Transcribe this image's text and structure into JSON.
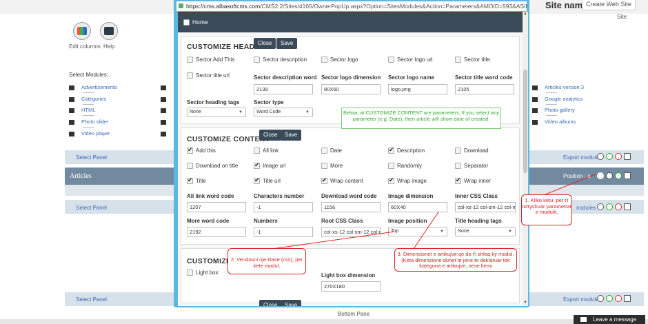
{
  "site": {
    "label": "Site name:",
    "button": "Create Web Site",
    "small": "Site:"
  },
  "background": {
    "edit_columns": "Edit columns",
    "help": "Help",
    "select_modules": "Select Modules:",
    "modules_col1": [
      "Advertisements",
      "Categories",
      "HTML",
      "Photo slider",
      "Video player"
    ],
    "modules_col2": [
      "Articles version 3",
      "Google analytics",
      "Photo gallery",
      "Video albums"
    ],
    "select_panel": "Select Panel",
    "articles": "Articles",
    "export_modules": "Export modules",
    "position": "Position : a",
    "modules_partial": "nodules",
    "bottom_pane": "Bottom Pane",
    "leave_message": "Leave a message"
  },
  "popup": {
    "url_host": "https://cms.albasoftcms.com",
    "url_path": "/CMS2.2/Sites/4165/OwnerPopUp.aspx?Option=SitesModules&Action=Parameters&AMOID=593&ASID=1&",
    "home": "Home",
    "buttons": {
      "close": "Close",
      "save": "Save"
    },
    "header": {
      "title": "CUSTOMIZE HEADER",
      "checks": [
        {
          "label": "Sector Add This",
          "checked": false
        },
        {
          "label": "Sector description",
          "checked": false
        },
        {
          "label": "Sector logo",
          "checked": false
        },
        {
          "label": "Sector logo url",
          "checked": false
        },
        {
          "label": "Sector title",
          "checked": false
        },
        {
          "label": "Sector title url",
          "checked": false
        }
      ],
      "fields": [
        {
          "label": "Sector description word",
          "value": "2139"
        },
        {
          "label": "Sector logo dimension",
          "value": "80X60"
        },
        {
          "label": "Sector logo name",
          "value": "logo.png"
        },
        {
          "label": "Sector title word code",
          "value": "2105"
        }
      ],
      "selects": [
        {
          "label": "Sector heading tags",
          "value": "None"
        },
        {
          "label": "Sector type",
          "value": "Word Code"
        }
      ]
    },
    "note": "Below, at CUSTOMIZE CONTENT are parameters. If you select any parameter (e.g. Date), then article will show date of created.",
    "content": {
      "title": "CUSTOMIZE CONTENT",
      "checks": [
        {
          "label": "Add this",
          "checked": true
        },
        {
          "label": "All link",
          "checked": false
        },
        {
          "label": "Date",
          "checked": false
        },
        {
          "label": "Description",
          "checked": true
        },
        {
          "label": "Download",
          "checked": false
        },
        {
          "label": "Download on title",
          "checked": false
        },
        {
          "label": "Image url",
          "checked": true
        },
        {
          "label": "More",
          "checked": false
        },
        {
          "label": "Randomly",
          "checked": false
        },
        {
          "label": "Separator",
          "checked": false
        },
        {
          "label": "Title",
          "checked": true
        },
        {
          "label": "Title url",
          "checked": true
        },
        {
          "label": "Wrap content",
          "checked": true
        },
        {
          "label": "Wrap image",
          "checked": true
        },
        {
          "label": "Wrap inner",
          "checked": true
        }
      ],
      "fields_row1": [
        {
          "label": "All link word code",
          "value": "1207"
        },
        {
          "label": "Characters number",
          "value": "-1"
        },
        {
          "label": "Download word code",
          "value": "1156"
        },
        {
          "label": "Image dimension",
          "value": "60X40"
        },
        {
          "label": "Inner CSS Class",
          "value": "col-xs-12 col-sm-12 col-md-"
        }
      ],
      "fields_row2": [
        {
          "label": "More word code",
          "value": "2192"
        },
        {
          "label": "Numbers",
          "value": "-1"
        },
        {
          "label": "Root CSS Class",
          "value": "col-xs-12 col-sm-12 col-md-"
        }
      ],
      "selects_row2": [
        {
          "label": "Image position",
          "value": "Top"
        },
        {
          "label": "Title heading tags",
          "value": "None"
        }
      ]
    },
    "third": {
      "title": "CUSTOMIZE",
      "light_box": "Light box",
      "light_box_dim_label": "Light box dimension",
      "light_box_dim_value": "270X180"
    }
  },
  "callouts": {
    "c1": "1. Kliko ketu, per t'i ndryshuar parametrat e modulit.",
    "c2": "2. Vendosni nje klase (css), per kete modul.",
    "c3": "3. Dimensionet e artikujve qe do t'i shfaq ky modul. (Keta dimenzione duhet te jene te deklaruar tek kategoria e artikujve, nese kemi"
  }
}
